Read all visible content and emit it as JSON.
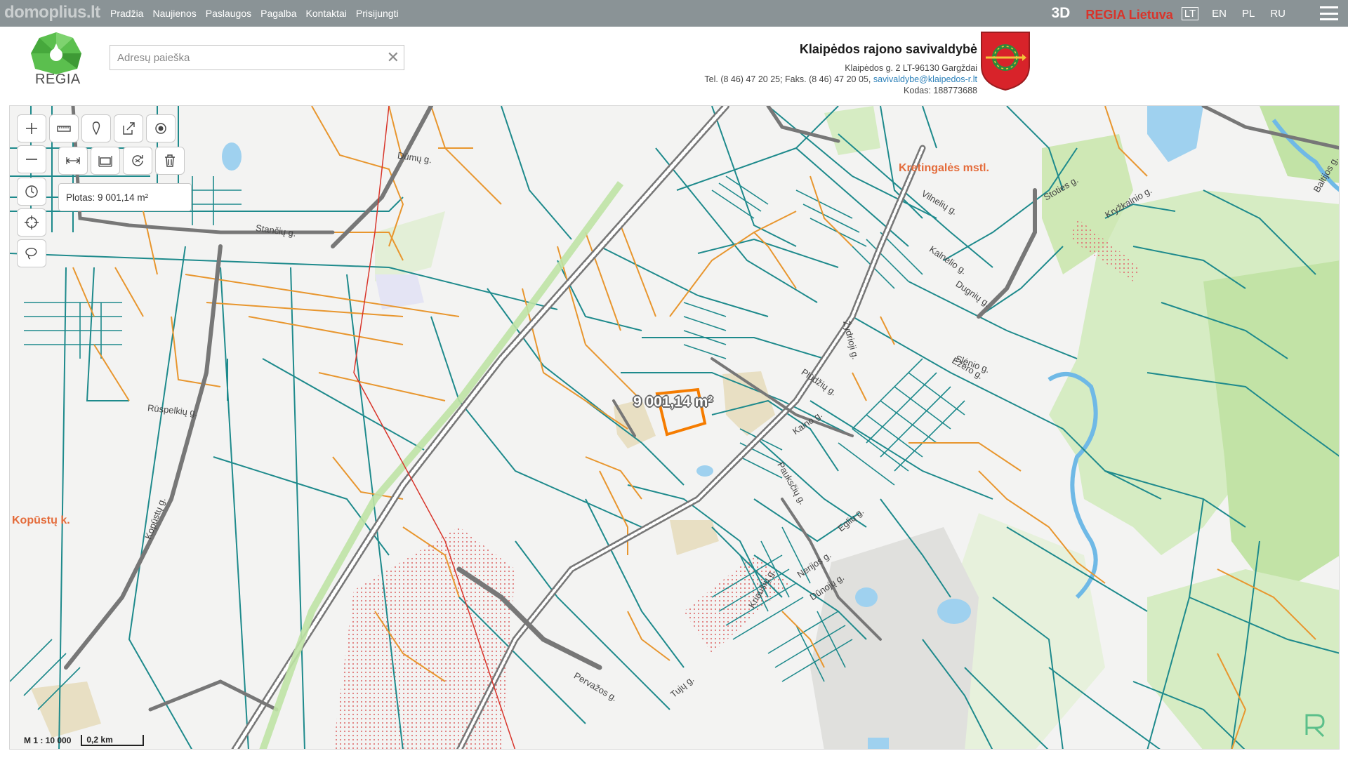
{
  "watermark": "domoplius.lt",
  "nav": {
    "items": [
      "Pradžia",
      "Naujienos",
      "Paslaugos",
      "Pagalba",
      "Kontaktai",
      "Prisijungti"
    ]
  },
  "right_nav": {
    "btn_3d": "3D",
    "regia_label": "REGIA Lietuva",
    "languages": [
      "LT",
      "EN",
      "PL",
      "RU"
    ],
    "active_language": "LT"
  },
  "logo": {
    "text": "REGIA"
  },
  "search": {
    "placeholder": "Adresų paieška",
    "value": "",
    "clear": "✕"
  },
  "municipality": {
    "name": "Klaipėdos rajono savivaldybė",
    "address": "Klaipėdos g. 2 LT-96130 Gargždai",
    "phone": "Tel. (8 46) 47 20 25; Faks. (8 46) 47 20 05, ",
    "email": "savivaldybe@klaipedos-r.lt",
    "code": "Kodas: 188773688"
  },
  "measure": {
    "text": "Plotas: 9 001,14 m²"
  },
  "map": {
    "area_label": "9 001,14 m²",
    "place_labels": {
      "kretinga": "Kretingalės mstl.",
      "kopustu": "Kopūstų k."
    },
    "street_labels": [
      "Dūmų g.",
      "Stančių g.",
      "Rūspelkių g.",
      "Kopūstų g.",
      "Vilnelių g.",
      "Kalnelio g.",
      "Ežero g.",
      "Plūdžių g.",
      "Kalno g.",
      "Pauksčių g.",
      "Nerijos g.",
      "Dūnojų g.",
      "Kriaušių g.",
      "Pervažos g.",
      "Stoties g.",
      "Baltijos g.",
      "Tujų g.",
      "Dugnių g.",
      "Kryžkalnio g.",
      "Žydrioji g.",
      "Eglių g.",
      "Slėnio g."
    ],
    "scale_text": "M 1 : 10 000",
    "scale_bar": "0,2 km",
    "colors": {
      "parcel": "#1e8a8c",
      "orange_parcel": "#e8962e",
      "road": "#777777",
      "forest": "#cfe8b5",
      "water": "#9fd1ef",
      "background": "#f3f3f2",
      "highlight": "#f57c00"
    }
  },
  "tools": {
    "zoom_in": "zoom-in-icon",
    "zoom_out": "zoom-out-icon",
    "measure_line": "ruler-icon",
    "pin": "pin-icon",
    "share": "share-icon",
    "locate": "target-icon",
    "measure_distance": "distance-icon",
    "measure_area": "area-icon",
    "refresh": "refresh-icon",
    "delete": "trash-icon",
    "history": "clock-icon",
    "crosshair": "crosshair-icon",
    "lasso": "lasso-icon"
  }
}
